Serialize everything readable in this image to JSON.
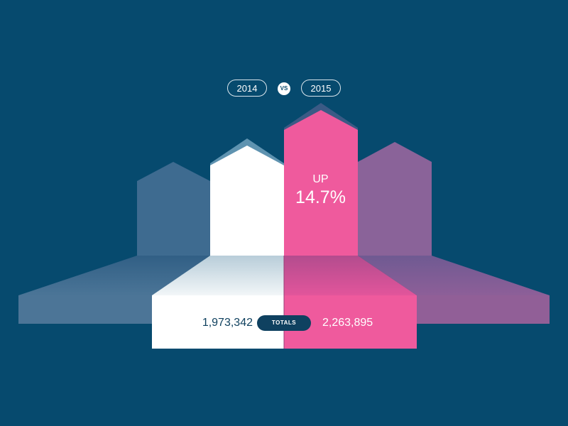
{
  "comparison": {
    "year_a": "2014",
    "vs": "VS",
    "year_b": "2015"
  },
  "change": {
    "label": "UP",
    "value": "14.7%"
  },
  "totals": {
    "label": "TOTALS",
    "value_a": "1,973,342",
    "value_b": "2,263,895"
  },
  "colors": {
    "background": "#064a6e",
    "year_a": "#ffffff",
    "year_b": "#ef5a9d",
    "side_left": "#3f6a8f",
    "side_right": "#8c6097"
  },
  "chart_data": {
    "type": "bar",
    "categories": [
      "2014",
      "2015"
    ],
    "values": [
      1973342,
      2263895
    ],
    "change_percent": 14.7,
    "change_direction": "up"
  }
}
